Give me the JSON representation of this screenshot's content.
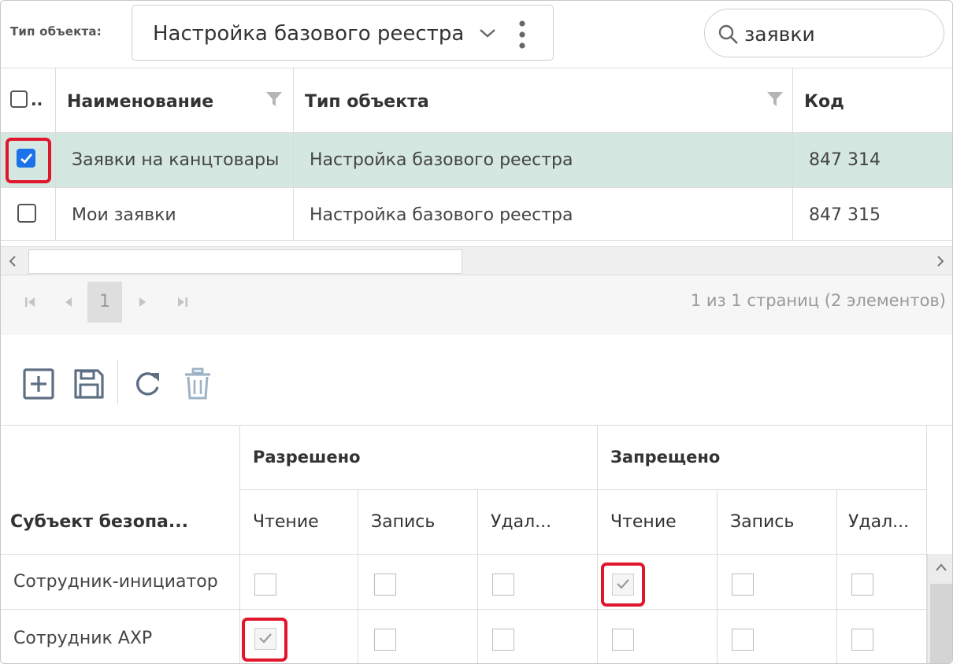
{
  "toolbar_top": {
    "type_label": "Тип объекта:",
    "type_value": "Настройка базового реестра",
    "search_value": "заявки"
  },
  "grid_objects": {
    "columns": [
      "...",
      "Наименование",
      "Тип объекта",
      "Код"
    ],
    "select_all_label": "..",
    "rows": [
      {
        "checked": true,
        "name": "Заявки на канцтовары",
        "type": "Настройка базового реестра",
        "code": "847 314"
      },
      {
        "checked": false,
        "name": "Мои заявки",
        "type": "Настройка базового реестра",
        "code": "847 315"
      }
    ]
  },
  "pager": {
    "page": "1",
    "info": "1 из 1 страниц (2 элементов)"
  },
  "actions": {
    "icons": [
      "add-icon",
      "save-icon",
      "refresh-icon",
      "delete-icon"
    ]
  },
  "permissions": {
    "subject_header": "Субъект безопа...",
    "groups": [
      "Разрешено",
      "Запрещено"
    ],
    "columns": [
      "Чтение",
      "Запись",
      "Удал...",
      "Чтение",
      "Запись",
      "Удал..."
    ],
    "rows": [
      {
        "subject": "Сотрудник-инициатор",
        "values": [
          false,
          false,
          false,
          true,
          false,
          false
        ]
      },
      {
        "subject": "Сотрудник АХР",
        "values": [
          true,
          false,
          false,
          false,
          false,
          false
        ]
      }
    ]
  },
  "colors": {
    "selected_row_bg": "#d4e7e1",
    "highlight": "#e0162b",
    "checkbox_checked": "#1a73e8"
  }
}
